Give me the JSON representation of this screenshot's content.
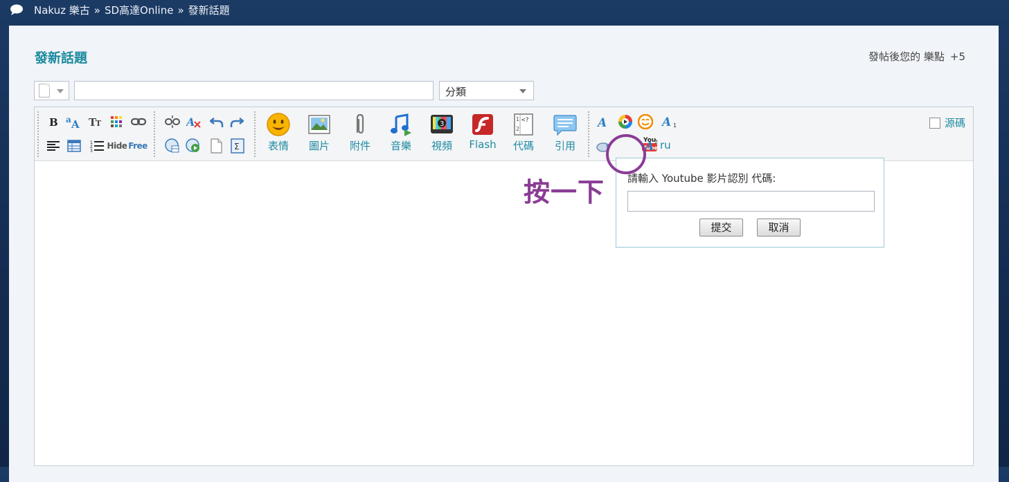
{
  "breadcrumb": {
    "items": [
      "Nakuz 樂古",
      "SD高達Online",
      "發新話題"
    ],
    "separator": "»"
  },
  "page": {
    "title": "發新話題",
    "points_text": "發帖後您的 樂點",
    "points_value": "+5"
  },
  "form": {
    "subject_value": "",
    "category_selected": "分類"
  },
  "toolbar": {
    "small_icons": [
      "bold-icon",
      "font-color-icon",
      "font-size-icon",
      "color-grid-icon",
      "link-icon",
      "unlink-icon",
      "clear-format-icon",
      "undo-icon",
      "redo-icon",
      "align-icon",
      "table-icon",
      "list-icon",
      "hide-icon",
      "free-icon",
      "insert-media-icon",
      "play-icon",
      "page-icon",
      "sigma-icon",
      "font-style-icon",
      "color-wheel-icon",
      "smiley-small-icon",
      "subscript-icon",
      "rotate-icon",
      "youtube-icon",
      "superscript-icon"
    ],
    "hide_text": "Hide",
    "free_text": "Free",
    "ru_text": "ru",
    "youtube_you": "You",
    "youtube_tube": "Tube",
    "big_buttons": [
      {
        "label": "表情",
        "icon": "smiley-icon"
      },
      {
        "label": "圖片",
        "icon": "image-icon"
      },
      {
        "label": "附件",
        "icon": "paperclip-icon"
      },
      {
        "label": "音樂",
        "icon": "music-icon"
      },
      {
        "label": "視頻",
        "icon": "video-icon"
      },
      {
        "label": "Flash",
        "icon": "flash-icon"
      },
      {
        "label": "代碼",
        "icon": "code-icon"
      },
      {
        "label": "引用",
        "icon": "quote-icon"
      }
    ],
    "source_label": "源碼"
  },
  "youtube_popup": {
    "prompt": "請輸入 Youtube 影片認別 代碼:",
    "input_value": "",
    "submit_label": "提交",
    "cancel_label": "取消"
  },
  "annotation": {
    "text": "按一下",
    "color": "#8a3c95"
  },
  "colors": {
    "header_bg": "#1b3a64",
    "panel_bg": "#f1f4f8",
    "accent": "#1f8ba3"
  }
}
